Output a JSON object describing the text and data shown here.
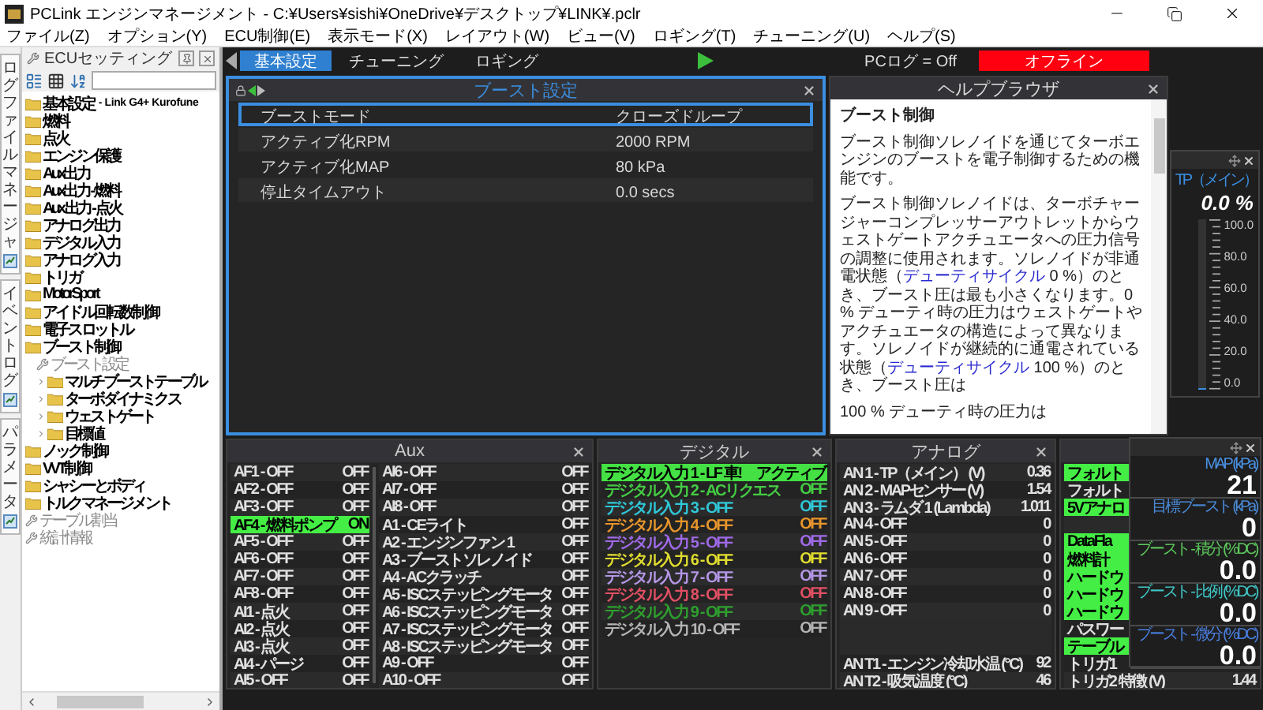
{
  "window": {
    "title": "PCLink エンジンマネージメント - C:¥Users¥sishi¥OneDrive¥デスクトップ¥LINK¥.pclr"
  },
  "menu": [
    "ファイル(Z)",
    "オプション(Y)",
    "ECU制御(E)",
    "表示モード(X)",
    "レイアウト(W)",
    "ビュー(V)",
    "ロギング(T)",
    "チューニング(U)",
    "ヘルプ(S)"
  ],
  "side_tabs": [
    "ログファイルマネージャ",
    "イベントログ",
    "パラメータ"
  ],
  "ecu_panel": {
    "title": "ECUセッティング",
    "tree": [
      {
        "label": "基本設定",
        "note": "- Link G4+ Kurofune",
        "kind": "folder"
      },
      {
        "label": "燃料",
        "kind": "folder"
      },
      {
        "label": "点火",
        "kind": "folder"
      },
      {
        "label": "エンジン保護",
        "kind": "folder"
      },
      {
        "label": "Aux出力",
        "kind": "folder"
      },
      {
        "label": "Aux出力 - 燃料",
        "kind": "folder"
      },
      {
        "label": "Aux 出力 - 点火",
        "kind": "folder"
      },
      {
        "label": "アナログ出力",
        "kind": "folder"
      },
      {
        "label": "デジタル入力",
        "kind": "folder"
      },
      {
        "label": "アナログ入力",
        "kind": "folder"
      },
      {
        "label": "トリガ",
        "kind": "folder"
      },
      {
        "label": "MotorSport",
        "kind": "folder"
      },
      {
        "label": "アイドル回転数制御",
        "kind": "folder"
      },
      {
        "label": "電子スロットル",
        "kind": "folder"
      },
      {
        "label": "ブースト制御",
        "kind": "folder",
        "expanded": true,
        "children": [
          {
            "label": "ブースト設定",
            "kind": "setting"
          },
          {
            "label": "マルチブーストテーブル",
            "kind": "folder",
            "expanded": false
          },
          {
            "label": "ターボダイナミクス",
            "kind": "folder",
            "expanded": false
          },
          {
            "label": "ウェストゲート",
            "kind": "folder",
            "expanded": false
          },
          {
            "label": "目標値",
            "kind": "folder",
            "expanded": false
          }
        ]
      },
      {
        "label": "ノック制御",
        "kind": "folder"
      },
      {
        "label": "VVT制御",
        "kind": "folder"
      },
      {
        "label": "シャシーとボディ",
        "kind": "folder"
      },
      {
        "label": "トルクマネージメント",
        "kind": "folder"
      },
      {
        "label": "テーブル割当",
        "kind": "setting"
      },
      {
        "label": "統計情報",
        "kind": "setting"
      }
    ]
  },
  "toolbar": {
    "tabs": [
      {
        "label": "基本設定",
        "selected": true
      },
      {
        "label": "チューニング",
        "selected": false
      },
      {
        "label": "ロギング",
        "selected": false
      }
    ],
    "pc_log": "PCログ = Off",
    "status": "オフライン"
  },
  "boost_settings": {
    "title": "ブースト設定",
    "rows": [
      {
        "name": "ブーストモード",
        "value": "クローズドループ",
        "selected": true
      },
      {
        "name": "アクティブ化RPM",
        "value": "2000 RPM",
        "selected": false
      },
      {
        "name": "アクティブ化MAP",
        "value": "80 kPa",
        "selected": false
      },
      {
        "name": "停止タイムアウト",
        "value": "0.0 secs",
        "selected": false
      }
    ]
  },
  "help": {
    "title": "ヘルプブラウザ",
    "heading": "ブースト制御",
    "paragraphs": [
      [
        {
          "text": "ブースト制御ソレノイドを通じてターボエンジンのブーストを電子制御するための機能です。"
        }
      ],
      [
        {
          "text": "ブースト制御ソレノイドは、ターボチャージャーコンプレッサーアウトレットからウェストゲートアクチュエータへの圧力信号の調整に使用されます。ソレノイドが非通電状態（"
        },
        {
          "text": "デューティサイクル",
          "link": true
        },
        {
          "text": " 0 %）のとき、ブースト圧は最も小さくなります。0 % デューティ時の圧力はウェストゲートやアクチュエータの構造によって異なります。ソレノイドが継続的に通電されている状態（"
        },
        {
          "text": "デューティサイクル",
          "link": true
        },
        {
          "text": " 100 %）のとき、ブースト圧は"
        }
      ],
      [
        {
          "text": "100 % デューティ時の圧力は"
        }
      ]
    ]
  },
  "tp_gauge": {
    "label": "TP（メイン）",
    "value": "0.0 %",
    "level": 0,
    "ticks": [
      "100.0",
      "80.0",
      "60.0",
      "40.0",
      "20.0",
      "0.0"
    ]
  },
  "aux": {
    "title": "Aux",
    "columns": [
      [
        {
          "label": "AF1 - OFF",
          "value": "OFF",
          "active": false
        },
        {
          "label": "AF2 - OFF",
          "value": "OFF",
          "active": false
        },
        {
          "label": "AF3 - OFF",
          "value": "OFF",
          "active": false
        },
        {
          "label": "AF4 - 燃料ポンプ",
          "value": "ON",
          "active": true
        },
        {
          "label": "AF5 - OFF",
          "value": "OFF",
          "active": false
        },
        {
          "label": "AF6 - OFF",
          "value": "OFF",
          "active": false
        },
        {
          "label": "AF7 - OFF",
          "value": "OFF",
          "active": false
        },
        {
          "label": "AF8 - OFF",
          "value": "OFF",
          "active": false
        },
        {
          "label": "AI1 - 点火",
          "value": "OFF",
          "active": false
        },
        {
          "label": "AI2 - 点火",
          "value": "OFF",
          "active": false
        },
        {
          "label": "AI3 - 点火",
          "value": "OFF",
          "active": false
        },
        {
          "label": "AI4 - パージ",
          "value": "OFF",
          "active": false
        },
        {
          "label": "AI5 - OFF",
          "value": "OFF",
          "active": false
        }
      ],
      [
        {
          "label": "AI6 - OFF",
          "value": "OFF",
          "active": false
        },
        {
          "label": "AI7 - OFF",
          "value": "OFF",
          "active": false
        },
        {
          "label": "AI8 - OFF",
          "value": "OFF",
          "active": false
        },
        {
          "label": "A1 - CEライト",
          "value": "OFF",
          "active": false
        },
        {
          "label": "A2 - エンジンファン 1",
          "value": "OFF",
          "active": false
        },
        {
          "label": "A3 - ブーストソレノイド",
          "value": "OFF",
          "active": false
        },
        {
          "label": "A4 - ACクラッチ",
          "value": "OFF",
          "active": false
        },
        {
          "label": "A5 - ISCステッピングモータ",
          "value": "OFF",
          "active": false
        },
        {
          "label": "A6 - ISCステッピングモータ",
          "value": "OFF",
          "active": false
        },
        {
          "label": "A7 - ISCステッピングモータ",
          "value": "OFF",
          "active": false
        },
        {
          "label": "A8 - ISCステッピングモータ",
          "value": "OFF",
          "active": false
        },
        {
          "label": "A9 - OFF",
          "value": "OFF",
          "active": false
        },
        {
          "label": "A10 - OFF",
          "value": "OFF",
          "active": false
        }
      ]
    ]
  },
  "digital": {
    "title": "デジタル",
    "rows": [
      {
        "label": "デジタル入力 1 - LF 車!",
        "value": "アクティブ",
        "active": true,
        "color": "#44e044"
      },
      {
        "label": "デジタル入力 2 - ACリクエス",
        "value": "OFF",
        "active": false,
        "color": "#44cc44"
      },
      {
        "label": "デジタル入力 3 - OFF",
        "value": "OFF",
        "active": false,
        "color": "#30c8d8"
      },
      {
        "label": "デジタル入力 4 - OFF",
        "value": "OFF",
        "active": false,
        "color": "#e8962c"
      },
      {
        "label": "デジタル入力 5 - OFF",
        "value": "OFF",
        "active": false,
        "color": "#a06ae8"
      },
      {
        "label": "デジタル入力 6 - OFF",
        "value": "OFF",
        "active": false,
        "color": "#e0dc30"
      },
      {
        "label": "デジタル入力 7 - OFF",
        "value": "OFF",
        "active": false,
        "color": "#b496e6"
      },
      {
        "label": "デジタル入力 8 - OFF",
        "value": "OFF",
        "active": false,
        "color": "#e05064"
      },
      {
        "label": "デジタル入力 9 - OFF",
        "value": "OFF",
        "active": false,
        "color": "#2ea02e"
      },
      {
        "label": "デジタル入力 10 - OFF",
        "value": "OFF",
        "active": false,
        "color": "#b4b4b4"
      }
    ]
  },
  "analog": {
    "title": "アナログ",
    "rows": [
      {
        "kind": "reading",
        "label": "AN 1 - TP（メイン） (V)",
        "value": "0.36"
      },
      {
        "kind": "reading",
        "label": "AN 2 - MAPセンサー (V)",
        "value": "1.54"
      },
      {
        "kind": "reading",
        "label": "AN 3 - ラムダ 1 (Lambda)",
        "value": "1.011"
      },
      {
        "kind": "reading",
        "label": "AN 4 - OFF",
        "value": "0"
      },
      {
        "kind": "reading",
        "label": "AN 5 - OFF",
        "value": "0"
      },
      {
        "kind": "reading",
        "label": "AN 6 - OFF",
        "value": "0"
      },
      {
        "kind": "reading",
        "label": "AN 7 - OFF",
        "value": "0"
      },
      {
        "kind": "reading",
        "label": "AN 8 - OFF",
        "value": "0"
      },
      {
        "kind": "reading",
        "label": "AN 9 - OFF",
        "value": "0"
      },
      {
        "kind": "blank"
      },
      {
        "kind": "blank"
      },
      {
        "kind": "reading",
        "label": "AN T1 - エンジン冷却水温 (°C)",
        "value": "92"
      },
      {
        "kind": "reading",
        "label": "AN T2 - 吸気温度 (°C)",
        "value": "46"
      }
    ]
  },
  "panel_4": {
    "rows": [
      {
        "kind": "reading",
        "label": "フォルト",
        "active": true
      },
      {
        "kind": "reading",
        "label": "フォルト",
        "active": false
      },
      {
        "kind": "reading",
        "label": "5Vアナロ",
        "active": true
      },
      {
        "kind": "blank"
      },
      {
        "kind": "reading",
        "label": "DataFla",
        "active": true
      },
      {
        "kind": "reading",
        "label": "燃料計",
        "active": true
      },
      {
        "kind": "reading",
        "label": "ハードウ",
        "active": true
      },
      {
        "kind": "reading",
        "label": "ハードウ",
        "active": true
      },
      {
        "kind": "reading",
        "label": "ハードウ",
        "active": true
      },
      {
        "kind": "reading",
        "label": "パスワー",
        "active": false
      },
      {
        "kind": "reading",
        "label": "テーブル",
        "active": true
      },
      {
        "kind": "reading",
        "label": "トリガ1",
        "active": false
      },
      {
        "kind": "reading",
        "label": "トリガ2 特徴 (V)",
        "value": "1.44",
        "active": false
      }
    ]
  },
  "boost_gauges": {
    "readouts": [
      {
        "label": "MAP (kPa)",
        "value": "21",
        "color": "#4a90e2"
      },
      {
        "label": "目標ブースト (kPa)",
        "value": "0",
        "color": "#4a8ad8"
      },
      {
        "label": "ブースト - 積分 (%DC)",
        "value": "0.0",
        "color": "#5cc85c"
      },
      {
        "label": "ブースト - 比例 (%DC)",
        "value": "0.0",
        "color": "#40c8c8"
      },
      {
        "label": "ブースト - 微分 (%DC)",
        "value": "0.0",
        "color": "#4a7fe0"
      }
    ]
  }
}
